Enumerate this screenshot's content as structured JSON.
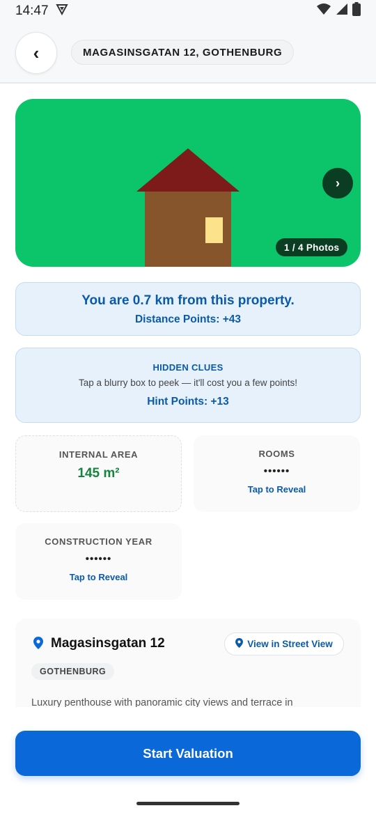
{
  "status_bar": {
    "time": "14:47"
  },
  "header": {
    "back_label": "‹",
    "address": "MAGASINSGATAN 12, GOTHENBURG"
  },
  "photos": {
    "next_label": "›",
    "counter": "1 / 4 Photos"
  },
  "distance": {
    "message": "You are 0.7 km from this property.",
    "points": "Distance Points: +43"
  },
  "clues": {
    "title": "HIDDEN CLUES",
    "description": "Tap a blurry box to peek — it'll cost you a few points!",
    "points": "Hint Points: +13"
  },
  "stats": [
    {
      "label": "INTERNAL AREA",
      "value": "145 m²"
    },
    {
      "label": "ROOMS",
      "value": "••••••",
      "action": "Tap to Reveal"
    },
    {
      "label": "CONSTRUCTION YEAR",
      "value": "••••••",
      "action": "Tap to Reveal"
    }
  ],
  "location": {
    "title": "Magasinsgatan 12",
    "street_view_label": "View in Street View",
    "city": "GOTHENBURG",
    "description": "Luxury penthouse with panoramic city views and terrace in"
  },
  "actions": {
    "start_label": "Start Valuation"
  },
  "colors": {
    "accent": "#0a68d9",
    "photo_bg": "#0cc46a",
    "info_bg": "#e6f1fb",
    "green_value": "#16843f"
  }
}
